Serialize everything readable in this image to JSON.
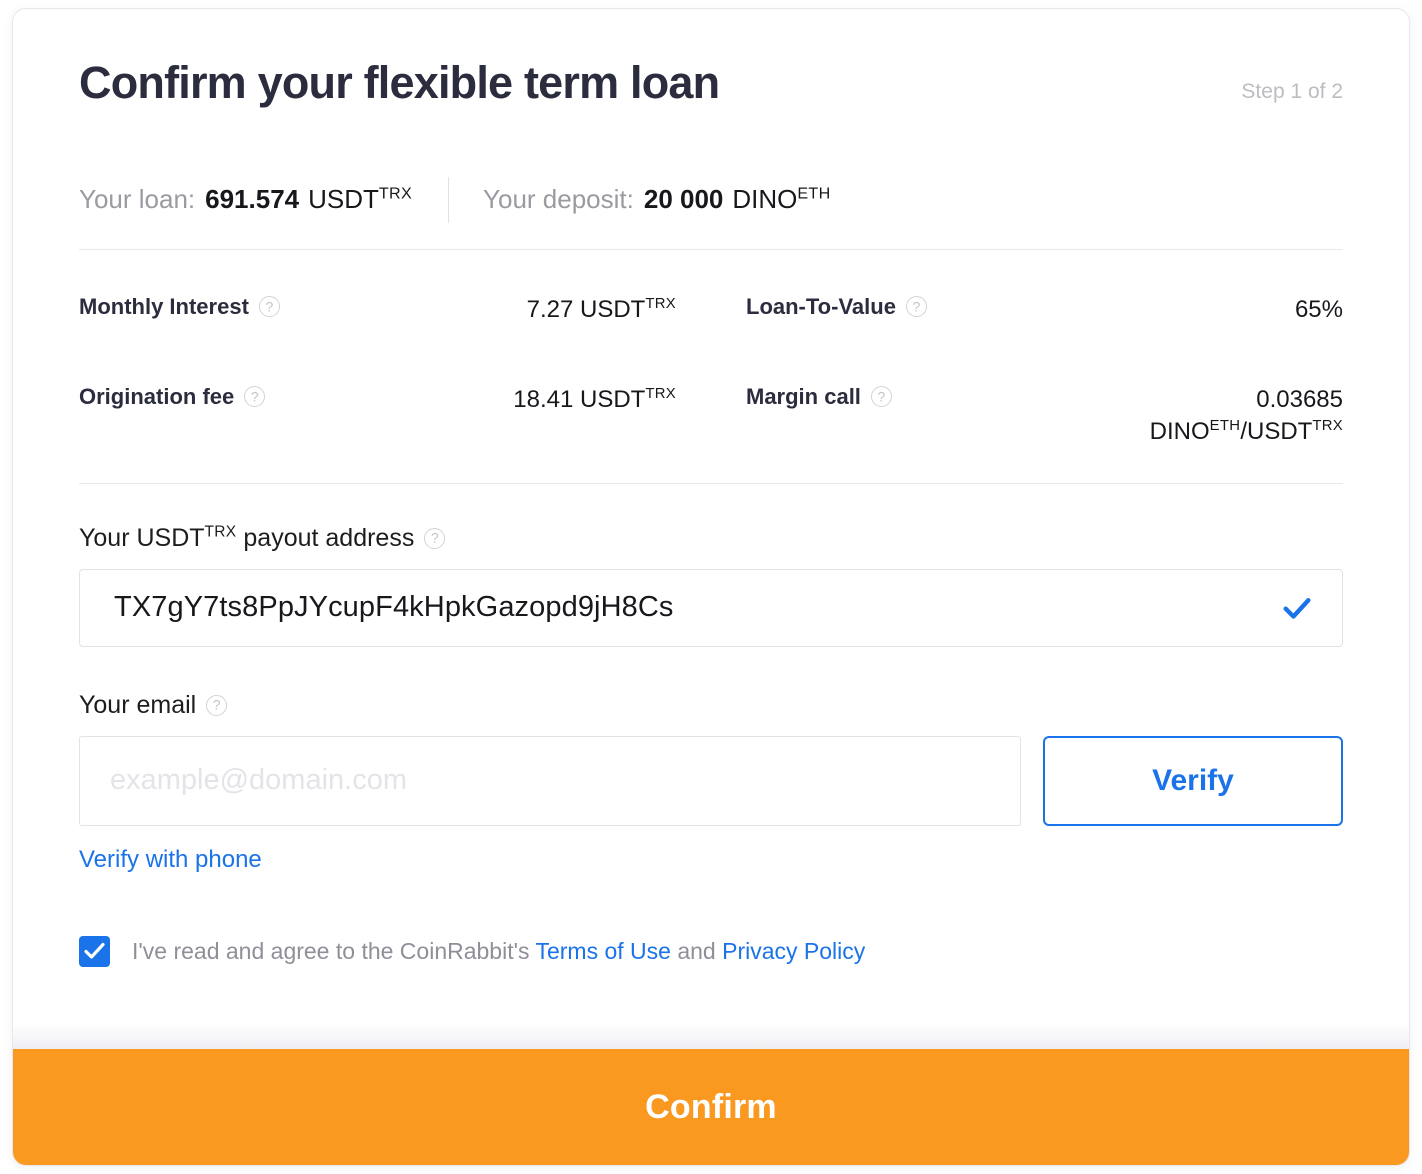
{
  "header": {
    "title": "Confirm your flexible term loan",
    "step": "Step 1 of 2"
  },
  "summary": {
    "loan": {
      "label": "Your loan:",
      "amount": "691.574",
      "currency": "USDT",
      "network": "TRX"
    },
    "deposit": {
      "label": "Your deposit:",
      "amount": "20 000",
      "currency": "DINO",
      "network": "ETH"
    }
  },
  "details": {
    "monthly_interest": {
      "label": "Monthly Interest",
      "value": "7.27 USDT",
      "value_network": "TRX"
    },
    "loan_to_value": {
      "label": "Loan-To-Value",
      "value": "65%"
    },
    "origination_fee": {
      "label": "Origination fee",
      "value": "18.41 USDT",
      "value_network": "TRX"
    },
    "margin_call": {
      "label": "Margin call",
      "value_number": "0.03685",
      "pair_base": "DINO",
      "pair_base_network": "ETH",
      "pair_quote": "USDT",
      "pair_quote_network": "TRX"
    }
  },
  "form": {
    "payout": {
      "label_prefix": "Your",
      "label_currency": "USDT",
      "label_network": "TRX",
      "label_suffix": "payout address",
      "address": "TX7gY7ts8PpJYcupF4kHpkGazopd9jH8Cs"
    },
    "email": {
      "label": "Your email",
      "value": "",
      "placeholder": "example@domain.com",
      "verify_label": "Verify",
      "phone_link": "Verify with phone"
    },
    "terms": {
      "checked": true,
      "text_before": "I've read and agree to the CoinRabbit's",
      "terms_link": "Terms of Use",
      "text_middle": "and",
      "privacy_link": "Privacy Policy"
    }
  },
  "footer": {
    "confirm_label": "Confirm"
  },
  "icons": {
    "help": "?"
  },
  "colors": {
    "accent_blue": "#1a73e8",
    "confirm_orange": "#fa991f",
    "title_dark": "#2b2d3e",
    "muted_gray": "#9a9aa2"
  }
}
